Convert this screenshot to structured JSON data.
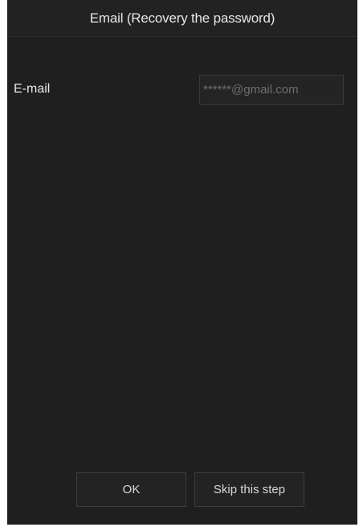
{
  "dialog": {
    "title": "Email (Recovery the password)"
  },
  "form": {
    "email_label": "E-mail",
    "email_placeholder": "******@gmail.com",
    "email_value": ""
  },
  "buttons": {
    "ok_label": "OK",
    "skip_label": "Skip this step"
  }
}
